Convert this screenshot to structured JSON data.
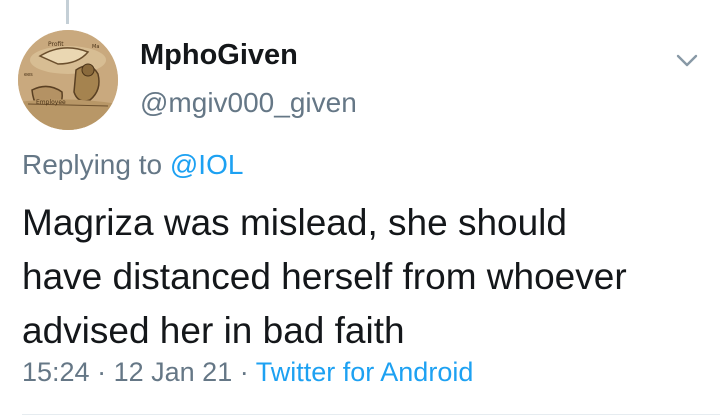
{
  "tweet": {
    "author": {
      "display_name": "MphoGiven",
      "handle": "@mgiv000_given",
      "avatar_labels": [
        "Profit",
        "Ma",
        "ees",
        "Employee"
      ]
    },
    "replying_prefix": "Replying to",
    "replying_to": "@IOL",
    "text_lines": [
      "Magriza was mislead, she should",
      "have distanced herself from whoever",
      "advised her in bad faith"
    ],
    "time": "15:24",
    "separator": "·",
    "date": "12 Jan 21",
    "source": "Twitter for Android"
  },
  "icons": {
    "more": "chevron-down-icon"
  },
  "colors": {
    "text": "#14171a",
    "secondary": "#657786",
    "link": "#1da1f2",
    "divider": "#e6ecf0"
  }
}
